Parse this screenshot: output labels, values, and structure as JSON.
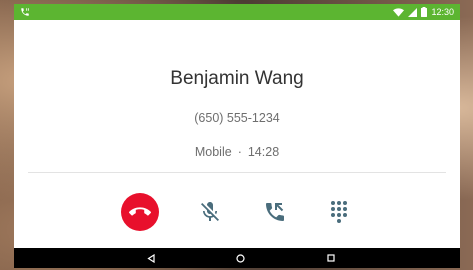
{
  "status_bar": {
    "time": "12:30",
    "left_icon": "phone-call-icon",
    "icons": [
      "wifi-icon",
      "signal-icon",
      "battery-icon"
    ],
    "color": "#5cb531"
  },
  "call": {
    "name": "Benjamin Wang",
    "number": "(650) 555-1234",
    "type": "Mobile",
    "separator": "·",
    "duration": "14:28"
  },
  "controls": [
    {
      "icon": "end-call-icon",
      "color": "#e8102c"
    },
    {
      "icon": "mic-off-icon"
    },
    {
      "icon": "call-transfer-icon"
    },
    {
      "icon": "dialpad-icon"
    }
  ],
  "nav": {
    "icons": [
      "back-icon",
      "home-icon",
      "recents-icon"
    ]
  }
}
